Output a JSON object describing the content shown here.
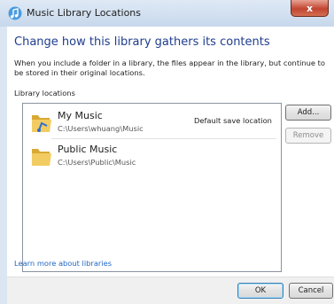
{
  "window": {
    "title": "Music Library Locations",
    "close_label": "x"
  },
  "heading": "Change how this library gathers its contents",
  "description": "When you include a folder in a library, the files appear in the library, but continue to be stored in their original locations.",
  "section_label": "Library locations",
  "locations": [
    {
      "name": "My Music",
      "path": "C:\\Users\\whuang\\Music",
      "badge": "Default save location",
      "icon": "music-folder-icon"
    },
    {
      "name": "Public Music",
      "path": "C:\\Users\\Public\\Music",
      "badge": "",
      "icon": "folder-icon"
    }
  ],
  "buttons": {
    "add": "Add...",
    "remove": "Remove",
    "ok": "OK",
    "cancel": "Cancel"
  },
  "learn_more_link": "Learn more about libraries",
  "colors": {
    "heading": "#1f3d8f",
    "link": "#1e66c2",
    "close_button": "#c24531"
  }
}
